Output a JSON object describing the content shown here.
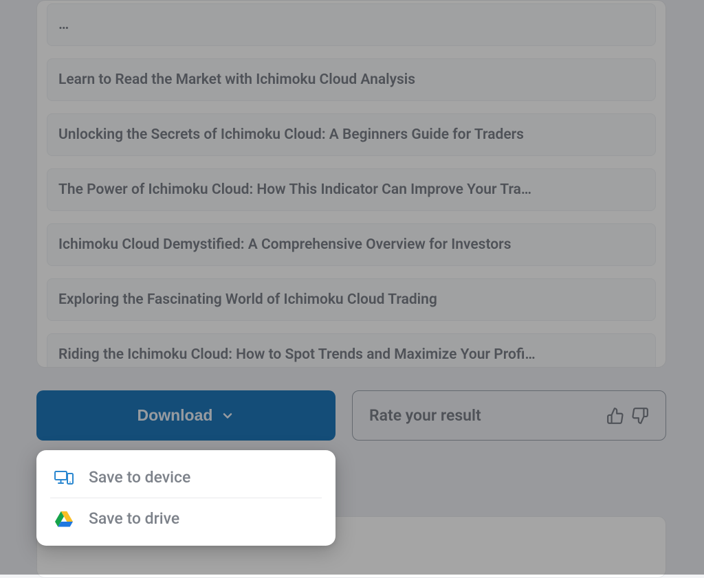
{
  "list": {
    "items": [
      {
        "title": "…"
      },
      {
        "title": "Learn to Read the Market with Ichimoku Cloud Analysis"
      },
      {
        "title": "Unlocking the Secrets of Ichimoku Cloud: A Beginners Guide for Traders"
      },
      {
        "title": "The Power of Ichimoku Cloud: How This Indicator Can Improve Your Tra…"
      },
      {
        "title": "Ichimoku Cloud Demystified: A Comprehensive Overview for Investors"
      },
      {
        "title": "Exploring the Fascinating World of Ichimoku Cloud Trading"
      },
      {
        "title": "Riding the Ichimoku Cloud: How to Spot Trends and Maximize Your Profi…"
      }
    ]
  },
  "download": {
    "label": "Download"
  },
  "rate": {
    "label": "Rate your result"
  },
  "menu": {
    "save_device": "Save to device",
    "save_drive": "Save to drive"
  },
  "colors": {
    "primary": "#1f77b8",
    "text_muted": "#7a7f87",
    "item_bg": "#f6f7f9",
    "accent_blue": "#2a87d0",
    "drive_blue": "#1f77e0",
    "drive_green": "#16a34a",
    "drive_yellow": "#fbbf24"
  }
}
